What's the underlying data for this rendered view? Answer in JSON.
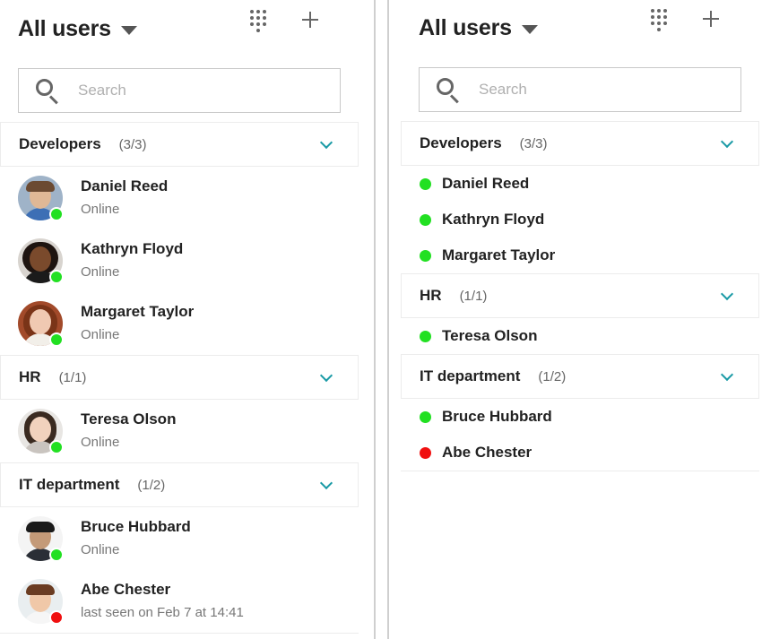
{
  "colors": {
    "online": "#22e022",
    "offline": "#f01010",
    "accent": "#1a9aa6"
  },
  "header": {
    "title": "All users",
    "caret_icon": "caret-down-icon",
    "grid_icon": "dialpad-icon",
    "add_icon": "plus-icon"
  },
  "search": {
    "placeholder": "Search",
    "value": ""
  },
  "groups": [
    {
      "name": "Developers",
      "count": "(3/3)"
    },
    {
      "name": "HR",
      "count": "(1/1)"
    },
    {
      "name": "IT department",
      "count": "(1/2)"
    }
  ],
  "users": [
    {
      "name": "Daniel Reed",
      "status": "Online",
      "online": true
    },
    {
      "name": "Kathryn Floyd",
      "status": "Online",
      "online": true
    },
    {
      "name": "Margaret Taylor",
      "status": "Online",
      "online": true
    },
    {
      "name": "Teresa Olson",
      "status": "Online",
      "online": true
    },
    {
      "name": "Bruce Hubbard",
      "status": "Online",
      "online": true
    },
    {
      "name": "Abe Chester",
      "status": "last seen on Feb 7 at 14:41",
      "online": false
    }
  ]
}
